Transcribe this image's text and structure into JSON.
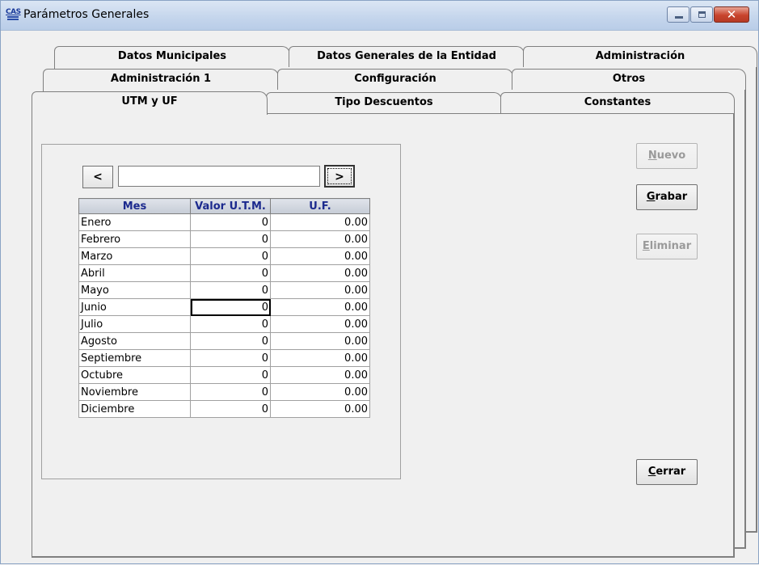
{
  "window": {
    "title": "Parámetros Generales",
    "icon_text": "CAS"
  },
  "tabs": {
    "row1": [
      "Datos Municipales",
      "Datos Generales de la Entidad",
      "Administración"
    ],
    "row2": [
      "Administración 1",
      "Configuración",
      "Otros"
    ],
    "row3": [
      "UTM y UF",
      "Tipo Descuentos",
      "Constantes"
    ],
    "active": "UTM y UF"
  },
  "nav": {
    "prev_label": "<",
    "next_label": ">",
    "field_value": ""
  },
  "table": {
    "headers": [
      "Mes",
      "Valor U.T.M.",
      "U.F."
    ],
    "rows": [
      [
        "Enero",
        "0",
        "0.00"
      ],
      [
        "Febrero",
        "0",
        "0.00"
      ],
      [
        "Marzo",
        "0",
        "0.00"
      ],
      [
        "Abril",
        "0",
        "0.00"
      ],
      [
        "Mayo",
        "0",
        "0.00"
      ],
      [
        "Junio",
        "0",
        "0.00"
      ],
      [
        "Julio",
        "0",
        "0.00"
      ],
      [
        "Agosto",
        "0",
        "0.00"
      ],
      [
        "Septiembre",
        "0",
        "0.00"
      ],
      [
        "Octubre",
        "0",
        "0.00"
      ],
      [
        "Noviembre",
        "0",
        "0.00"
      ],
      [
        "Diciembre",
        "0",
        "0.00"
      ]
    ]
  },
  "buttons": {
    "nuevo": {
      "first": "N",
      "rest": "uevo"
    },
    "grabar": {
      "first": "G",
      "rest": "rabar"
    },
    "eliminar": {
      "first": "E",
      "rest": "liminar"
    },
    "cerrar": {
      "first": "C",
      "rest": "errar"
    }
  },
  "colors": {
    "header_text": "#1c2a8e",
    "close_button": "#c8442d"
  },
  "icons": [
    "app-icon",
    "minimize-icon",
    "maximize-icon",
    "close-icon"
  ]
}
